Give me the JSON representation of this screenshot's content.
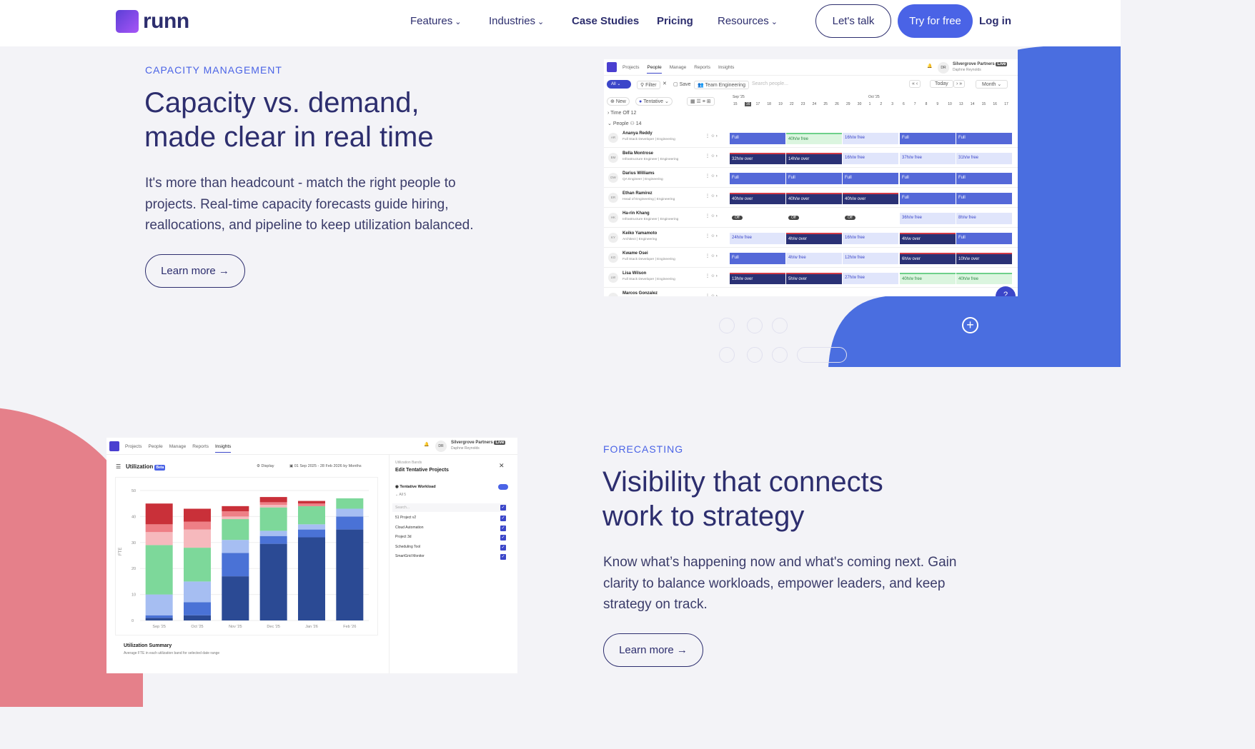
{
  "nav": {
    "logo": "runn",
    "features": "Features",
    "industries": "Industries",
    "case_studies": "Case Studies",
    "pricing": "Pricing",
    "resources": "Resources",
    "lets_talk": "Let's talk",
    "try_free": "Try for free",
    "login": "Log in"
  },
  "s1": {
    "eyebrow": "CAPACITY MANAGEMENT",
    "title_1": "Capacity vs. demand,",
    "title_2": "made clear in real time",
    "body": "It's more than headcount - match the right people to projects. Real-time capacity forecasts guide hiring, reallocations, and pipeline to keep utilization balanced.",
    "learn": "Learn more →"
  },
  "s2": {
    "eyebrow": "FORECASTING",
    "title_1": "Visibility that connects",
    "title_2": "work to strategy",
    "body": "Know what’s happening now and what's coming next. Gain clarity to balance workloads, empower leaders, and keep strategy on track.",
    "learn": "Learn more →"
  },
  "app1": {
    "tabs": [
      "Projects",
      "People",
      "Manage",
      "Reports",
      "Insights"
    ],
    "org": "Silvergrove Partners",
    "badge": "Live",
    "user": "Daphne Reynolds",
    "initials": "DR",
    "filter_all": "All",
    "filter": "Filter",
    "save": "Save",
    "team": "Team Engineering",
    "search": "Search people...",
    "today": "Today",
    "month": "Month",
    "new": "New",
    "tentative": "Tentative",
    "month1": "Sep '25",
    "month2": "Oct '25",
    "time_off": "Time Off",
    "time_off_count": "12",
    "people": "People",
    "people_count": "14",
    "rows": [
      {
        "ini": "AR",
        "name": "Ananya Reddy",
        "role": "Full Stack Developer | Engineering",
        "cells": [
          "Full",
          "40h/w free",
          "16h/w free",
          "Full",
          "Full"
        ]
      },
      {
        "ini": "BM",
        "name": "Bella Montrose",
        "role": "Infrastructure Engineer | Engineering",
        "cells": [
          "32h/w over",
          "14h/w over",
          "16h/w free",
          "37h/w free",
          "31h/w free"
        ]
      },
      {
        "ini": "DW",
        "name": "Darius Williams",
        "role": "QA Engineer | Engineering",
        "cells": [
          "Full",
          "Full",
          "Full",
          "Full",
          "Full"
        ]
      },
      {
        "ini": "ER",
        "name": "Ethan Ramirez",
        "role": "Head of Engineering | Engineering",
        "cells": [
          "40h/w over",
          "40h/w over",
          "40h/w over",
          "Full",
          "Full"
        ]
      },
      {
        "ini": "HK",
        "name": "Ha-rin Khang",
        "role": "Infrastructure Engineer | Engineering",
        "cells": [
          "Off",
          "Off",
          "Off",
          "36h/w free",
          "8h/w free"
        ]
      },
      {
        "ini": "KY",
        "name": "Keiko Yamamoto",
        "role": "Architect | Engineering",
        "cells": [
          "24h/w free",
          "4h/w over",
          "16h/w free",
          "4h/w over",
          "Full"
        ]
      },
      {
        "ini": "KO",
        "name": "Kwame Osei",
        "role": "Full Stack Developer | Engineering",
        "cells": [
          "Full",
          "4h/w free",
          "12h/w free",
          "6h/w over",
          "10h/w over"
        ]
      },
      {
        "ini": "LW",
        "name": "Lisa Wilson",
        "role": "Full Stack Developer | Engineering",
        "cells": [
          "13h/w over",
          "5h/w over",
          "27h/w free",
          "40h/w free",
          "40h/w free"
        ]
      },
      {
        "ini": "MG",
        "name": "Marcos Gonzalez",
        "role": "",
        "cells": []
      }
    ]
  },
  "app2": {
    "tabs": [
      "Projects",
      "People",
      "Manage",
      "Reports",
      "Insights"
    ],
    "org": "Silvergrove Partners",
    "badge": "Live",
    "user": "Daphne Reynolds",
    "initials": "DR",
    "title": "Utilization",
    "beta": "Beta",
    "display": "Display",
    "range": "01 Sep 2025 - 28 Feb 2026 by Months",
    "ylabel": "FTE",
    "summary": "Utilization Summary",
    "summary_sub": "Average FTE in each utilization band for selected date range",
    "panel": {
      "eyebrow": "Utilization Bands",
      "title": "Edit Tentative Projects",
      "toggle": "Tentative Workload",
      "all": "All 5",
      "search": "Search...",
      "projects": [
        "51 Project v2",
        "Cloud Automation",
        "Project 3d",
        "Scheduling Tool",
        "SmartGrid Monitor"
      ]
    }
  },
  "chart_data": {
    "type": "bar",
    "categories": [
      "Sep '25",
      "Oct '25",
      "Nov '25",
      "Dec '25",
      "Jan '26",
      "Feb '26"
    ],
    "ylim": [
      0,
      50
    ],
    "yticks": [
      0,
      10,
      20,
      30,
      40,
      50
    ],
    "ylabel": "FTE",
    "series": [
      {
        "color": "#2b4a94",
        "values": [
          1,
          2,
          17,
          29.5,
          32,
          35
        ]
      },
      {
        "color": "#4a72d6",
        "values": [
          1,
          5,
          9,
          3,
          3,
          5
        ]
      },
      {
        "color": "#a6bef2",
        "values": [
          8,
          8,
          5,
          2,
          2,
          3
        ]
      },
      {
        "color": "#7dd89a",
        "values": [
          19,
          13,
          8,
          9,
          7,
          4
        ]
      },
      {
        "color": "#f6b9bd",
        "values": [
          5,
          7,
          1,
          1,
          0,
          0
        ]
      },
      {
        "color": "#ee7f86",
        "values": [
          3,
          3,
          2,
          1,
          1,
          0
        ]
      },
      {
        "color": "#c93039",
        "values": [
          8,
          5,
          2,
          2,
          1,
          0
        ]
      }
    ]
  },
  "colors": {
    "accent": "#4a63e6",
    "navy": "#2d2e6e",
    "pink": "#e5808a"
  }
}
